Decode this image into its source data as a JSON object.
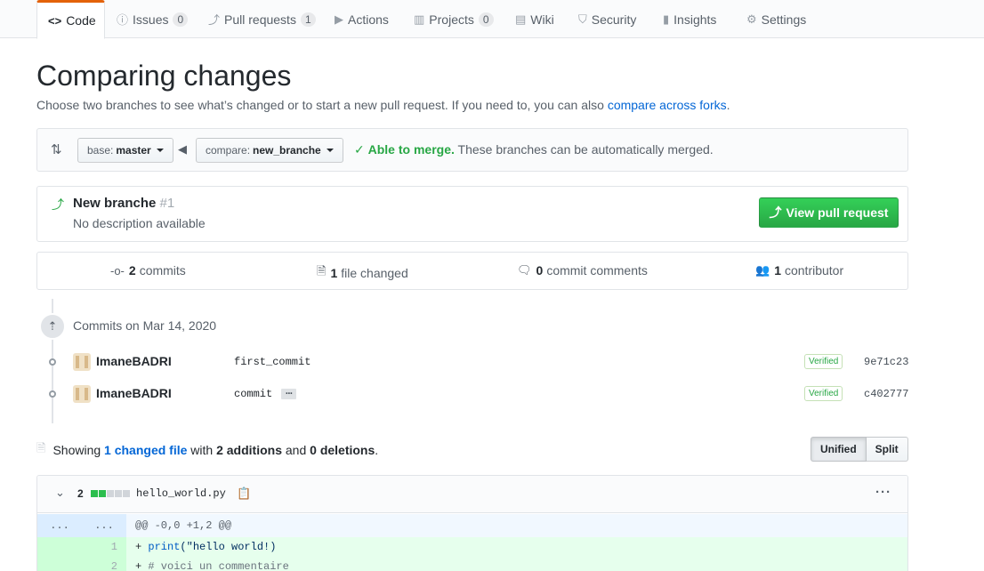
{
  "nav": {
    "tabs": [
      {
        "label": "Code",
        "icon": "code-icon",
        "selected": true
      },
      {
        "label": "Issues",
        "icon": "issue-icon",
        "count": "0"
      },
      {
        "label": "Pull requests",
        "icon": "pull-request-icon",
        "count": "1"
      },
      {
        "label": "Actions",
        "icon": "play-icon"
      },
      {
        "label": "Projects",
        "icon": "project-icon",
        "count": "0"
      },
      {
        "label": "Wiki",
        "icon": "book-icon"
      },
      {
        "label": "Security",
        "icon": "shield-icon"
      },
      {
        "label": "Insights",
        "icon": "graph-icon"
      },
      {
        "label": "Settings",
        "icon": "gear-icon"
      }
    ]
  },
  "header": {
    "title": "Comparing changes",
    "subtitle": "Choose two branches to see what’s changed or to start a new pull request. If you need to, you can also",
    "forks_link": "compare across forks",
    "subtitle_end": "."
  },
  "range": {
    "base_prefix": "base:",
    "base_branch": "master",
    "compare_prefix": "compare:",
    "compare_branch": "new_branche",
    "merge_status": "Able to merge.",
    "merge_text": "These branches can be automatically merged."
  },
  "pull_request": {
    "title": "New branche",
    "number": "#1",
    "description": "No description available",
    "view_button": "View pull request"
  },
  "summary": {
    "commits_count": "2",
    "commits_label": "commits",
    "files_count": "1",
    "files_label": "file changed",
    "comments_count": "0",
    "comments_label": "commit comments",
    "contributors_count": "1",
    "contributors_label": "contributor"
  },
  "commits": {
    "date_label": "Commits on Mar 14, 2020",
    "items": [
      {
        "author": "ImaneBADRI",
        "message": "first_commit",
        "verified": "Verified",
        "sha": "9e71c23"
      },
      {
        "author": "ImaneBADRI",
        "message": "commit",
        "more": "…",
        "verified": "Verified",
        "sha": "c402777"
      }
    ]
  },
  "diff": {
    "showing": "Showing",
    "changed_files": "1 changed file",
    "with": "with",
    "additions": "2 additions",
    "and": "and",
    "deletions": "0 deletions",
    "end": ".",
    "view_unified": "Unified",
    "view_split": "Split",
    "file": {
      "change_count": "2",
      "name": "hello_world.py",
      "hunk_left": "...",
      "hunk_right": "...",
      "hunk_header": "@@ -0,0 +1,2 @@",
      "lines": [
        {
          "num": "1",
          "prefix": "+ ",
          "fn": "print",
          "str": "(\"hello world!)"
        },
        {
          "num": "2",
          "prefix": "+ ",
          "comment": "# voici un commentaire"
        }
      ]
    }
  },
  "colors": {
    "accent_orange": "#e36209",
    "link_blue": "#0366d6",
    "success_green": "#28a745"
  }
}
